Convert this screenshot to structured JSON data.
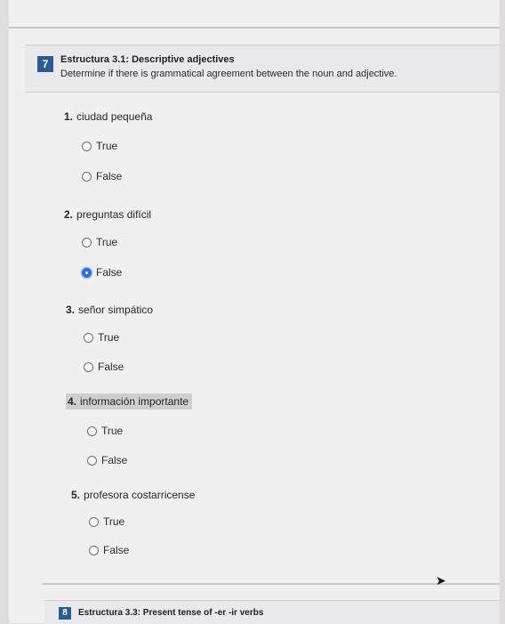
{
  "question": {
    "number": "7",
    "title": "Estructura 3.1: Descriptive adjectives",
    "instruction": "Determine if there is grammatical agreement between the noun and adjective."
  },
  "items": [
    {
      "num": "1.",
      "text": "ciudad pequeña",
      "options": [
        {
          "label": "True",
          "selected": false
        },
        {
          "label": "False",
          "selected": false
        }
      ]
    },
    {
      "num": "2.",
      "text": "preguntas difícil",
      "options": [
        {
          "label": "True",
          "selected": false
        },
        {
          "label": "False",
          "selected": true
        }
      ]
    },
    {
      "num": "3.",
      "text": "señor simpático",
      "options": [
        {
          "label": "True",
          "selected": false
        },
        {
          "label": "False",
          "selected": false
        }
      ]
    },
    {
      "num": "4.",
      "text": "información importante",
      "highlighted": true,
      "options": [
        {
          "label": "True",
          "selected": false
        },
        {
          "label": "False",
          "selected": false
        }
      ]
    },
    {
      "num": "5.",
      "text": "profesora costarricense",
      "options": [
        {
          "label": "True",
          "selected": false
        },
        {
          "label": "False",
          "selected": false
        }
      ]
    }
  ],
  "next_question": {
    "number": "8",
    "title": "Estructura 3.3: Present tense of -er -ir verbs"
  },
  "colors": {
    "badge": "#2a5c93",
    "radio_selected": "#2e6fd8"
  }
}
